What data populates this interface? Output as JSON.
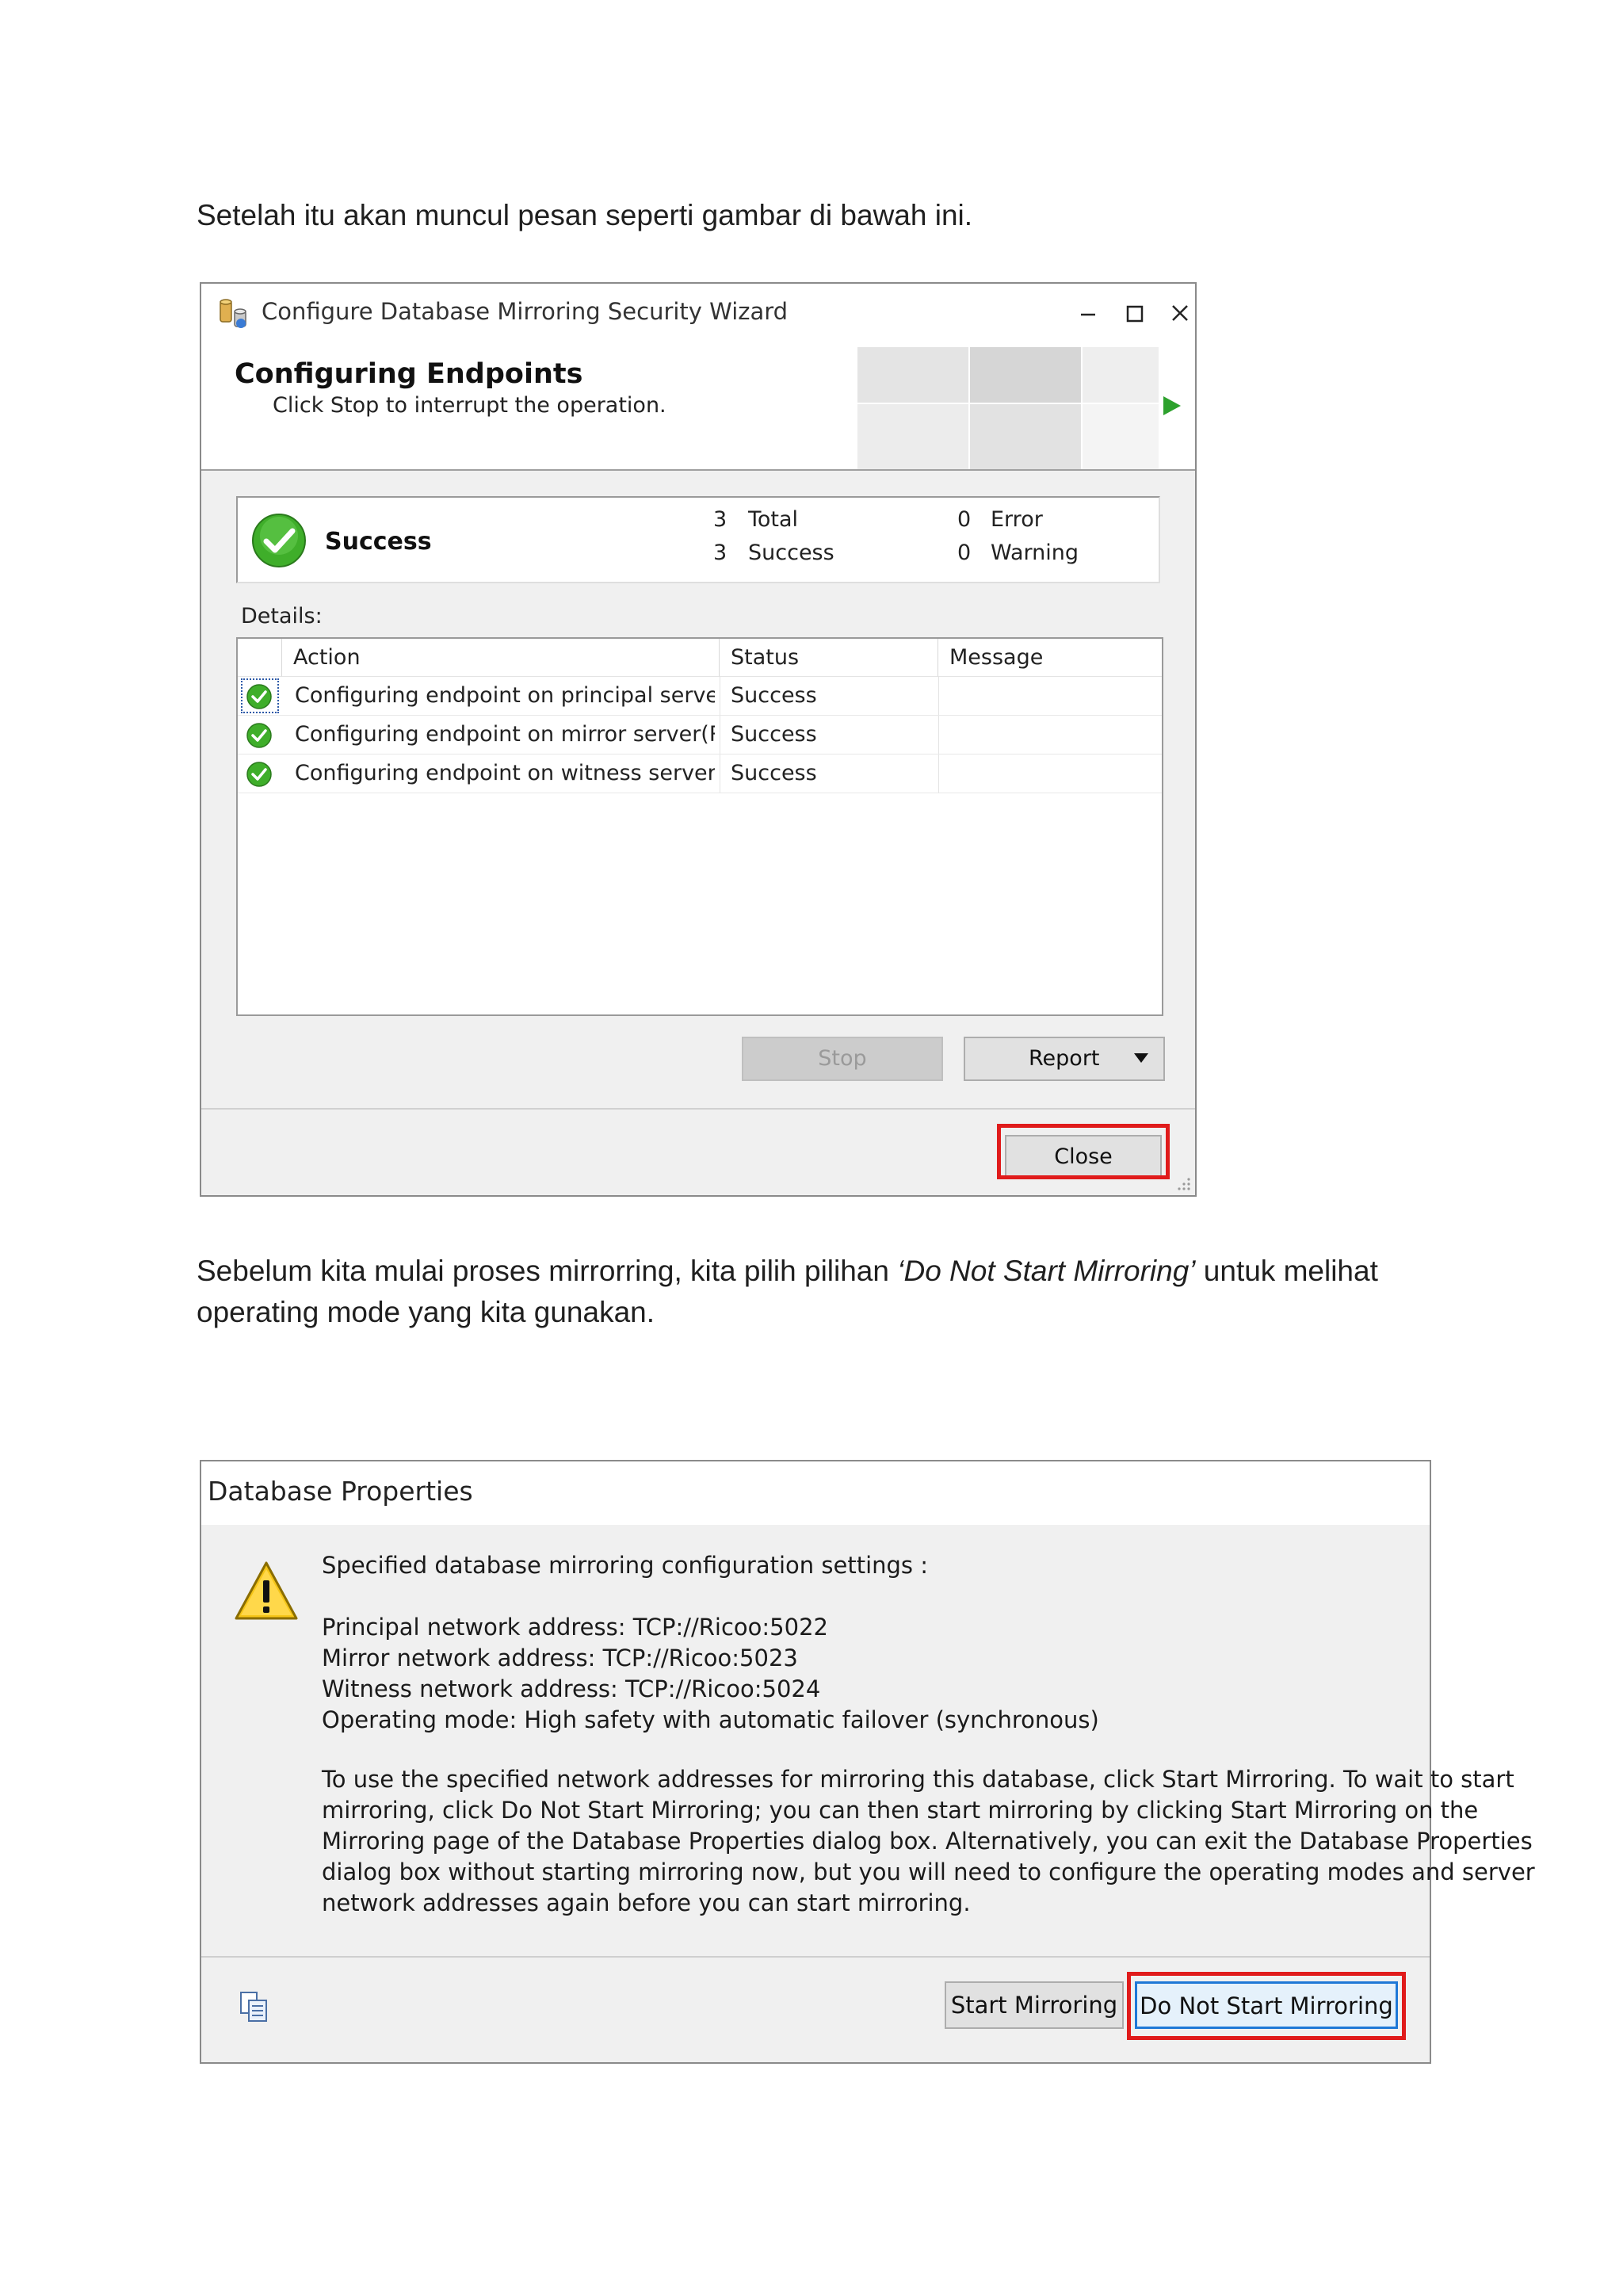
{
  "paragraphs": {
    "p1": "Setelah itu akan muncul pesan seperti gambar di bawah ini.",
    "p2_before": "Sebelum kita mulai proses mirrorring, kita pilih pilihan ",
    "p2_italic": "‘Do Not Start Mirroring’",
    "p2_after": " untuk melihat operating mode yang kita gunakan."
  },
  "wizard": {
    "title": "Configure Database Mirroring Security Wizard",
    "heading": "Configuring Endpoints",
    "subheading": "Click Stop to interrupt the operation.",
    "summary": {
      "status": "Success",
      "total_count": "3",
      "total_label": "Total",
      "success_count": "3",
      "success_label": "Success",
      "error_count": "0",
      "error_label": "Error",
      "warning_count": "0",
      "warning_label": "Warning"
    },
    "details_label": "Details:",
    "columns": {
      "action": "Action",
      "status": "Status",
      "message": "Message"
    },
    "rows": [
      {
        "action": "Configuring endpoint on principal server(...",
        "status": "Success",
        "message": ""
      },
      {
        "action": "Configuring endpoint on mirror server(RI...",
        "status": "Success",
        "message": ""
      },
      {
        "action": "Configuring endpoint on witness server(...",
        "status": "Success",
        "message": ""
      }
    ],
    "stop_label": "Stop",
    "report_label": "Report",
    "close_label": "Close",
    "icons": {
      "app": "database-wizard-icon",
      "status": "success-check-icon",
      "play": "play-icon"
    },
    "colors": {
      "success": "#3fae2a",
      "highlight": "#e01b1b"
    }
  },
  "dbprops": {
    "title": "Database Properties",
    "intro": "Specified database mirroring configuration settings :",
    "addresses": [
      "Principal network address: TCP://Ricoo:5022",
      "Mirror network address: TCP://Ricoo:5023",
      "Witness network address: TCP://Ricoo:5024",
      "Operating mode: High safety with automatic failover (synchronous)"
    ],
    "body_lines": [
      "To use the specified network addresses for mirroring this database, click Start Mirroring.  To wait to start",
      "mirroring, click Do Not Start Mirroring; you can then start mirroring by clicking Start Mirroring on the",
      "Mirroring page of the Database Properties dialog box. Alternatively, you can exit the Database Properties",
      "dialog box without starting mirroring now, but you will need to configure the operating modes and server",
      "network addresses again before you can start mirroring."
    ],
    "start_label": "Start Mirroring",
    "dont_start_label": "Do Not Start Mirroring",
    "icons": {
      "warning": "warning-icon",
      "copy": "copy-icon"
    },
    "colors": {
      "default_button_border": "#1e78d7",
      "highlight": "#e01b1b"
    }
  }
}
